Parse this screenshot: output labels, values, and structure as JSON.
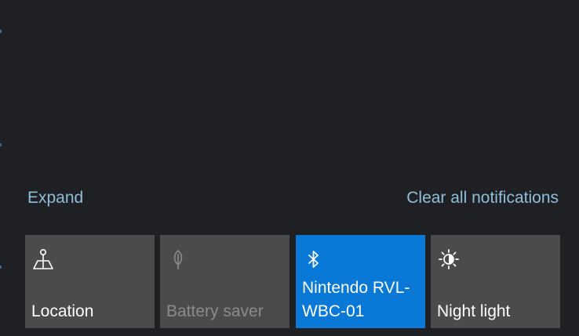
{
  "action_center": {
    "expand_label": "Expand",
    "clear_all_label": "Clear all notifications",
    "quick_actions": [
      {
        "label": "Location",
        "icon": "location-icon",
        "state": "off"
      },
      {
        "label": "Battery saver",
        "icon": "leaf-icon",
        "state": "disabled"
      },
      {
        "label": "Nintendo RVL-WBC-01",
        "icon": "bluetooth-icon",
        "state": "on"
      },
      {
        "label": "Night light",
        "icon": "night-light-icon",
        "state": "off"
      }
    ]
  },
  "colors": {
    "background": "#1f2023",
    "tile": "#4b4b4d",
    "tile_active": "#0a78d7",
    "link": "#8fbfd9",
    "disabled_text": "#8b8b8d"
  }
}
